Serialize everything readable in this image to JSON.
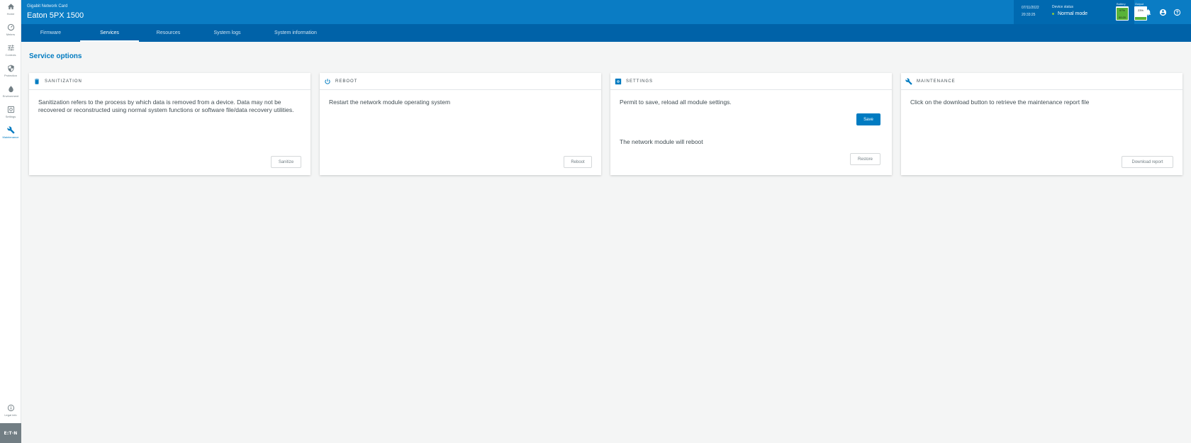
{
  "sidebar": {
    "items": [
      {
        "label": "Home",
        "icon": "home-icon"
      },
      {
        "label": "Meters",
        "icon": "gauge-icon"
      },
      {
        "label": "Controls",
        "icon": "sliders-icon"
      },
      {
        "label": "Protection",
        "icon": "shield-icon"
      },
      {
        "label": "Environment",
        "icon": "droplet-icon"
      },
      {
        "label": "Settings",
        "icon": "settings-icon"
      },
      {
        "label": "Maintenance",
        "icon": "wrench-icon"
      }
    ],
    "legal": {
      "label": "Legal info",
      "icon": "info-icon"
    },
    "logo": "E:T·N",
    "active_color": "#007bc1"
  },
  "header": {
    "subtitle": "Gigabit Network Card",
    "title": "Eaton 5PX 1500",
    "date": "07/11/2022",
    "time": "20:33:25",
    "device_status_label": "Device status",
    "device_status_value": "Normal mode",
    "battery_label": "Battery",
    "battery_percent_text": "97%",
    "battery_time_text": "00:20",
    "battery_level": 0.97,
    "output_label": "Output",
    "output_percent_text": "23%",
    "output_level": 0.23,
    "brand_color": "#0a7cc4"
  },
  "tabs": [
    {
      "label": "Firmware"
    },
    {
      "label": "Services"
    },
    {
      "label": "Resources"
    },
    {
      "label": "System logs"
    },
    {
      "label": "System information"
    }
  ],
  "main": {
    "title": "Service options",
    "cards": [
      {
        "title": "SANITIZATION",
        "icon": "trash-icon",
        "text": "Sanitization refers to the process by which data is removed from a device. Data may not be recovered or reconstructed using normal system functions or software file/data recovery utilities.",
        "button": "Sanitize"
      },
      {
        "title": "REBOOT",
        "icon": "power-icon",
        "text": "Restart the network module operating system",
        "button": "Reboot"
      },
      {
        "title": "SETTINGS",
        "icon": "settings-icon",
        "text": "Permit to save, reload all module settings.",
        "primary_button": "Save",
        "text2": "The network module will reboot",
        "button": "Restore"
      },
      {
        "title": "MAINTENANCE",
        "icon": "wrench-icon",
        "text": "Click on the download button to retrieve the maintenance report file",
        "button": "Download report"
      }
    ]
  }
}
